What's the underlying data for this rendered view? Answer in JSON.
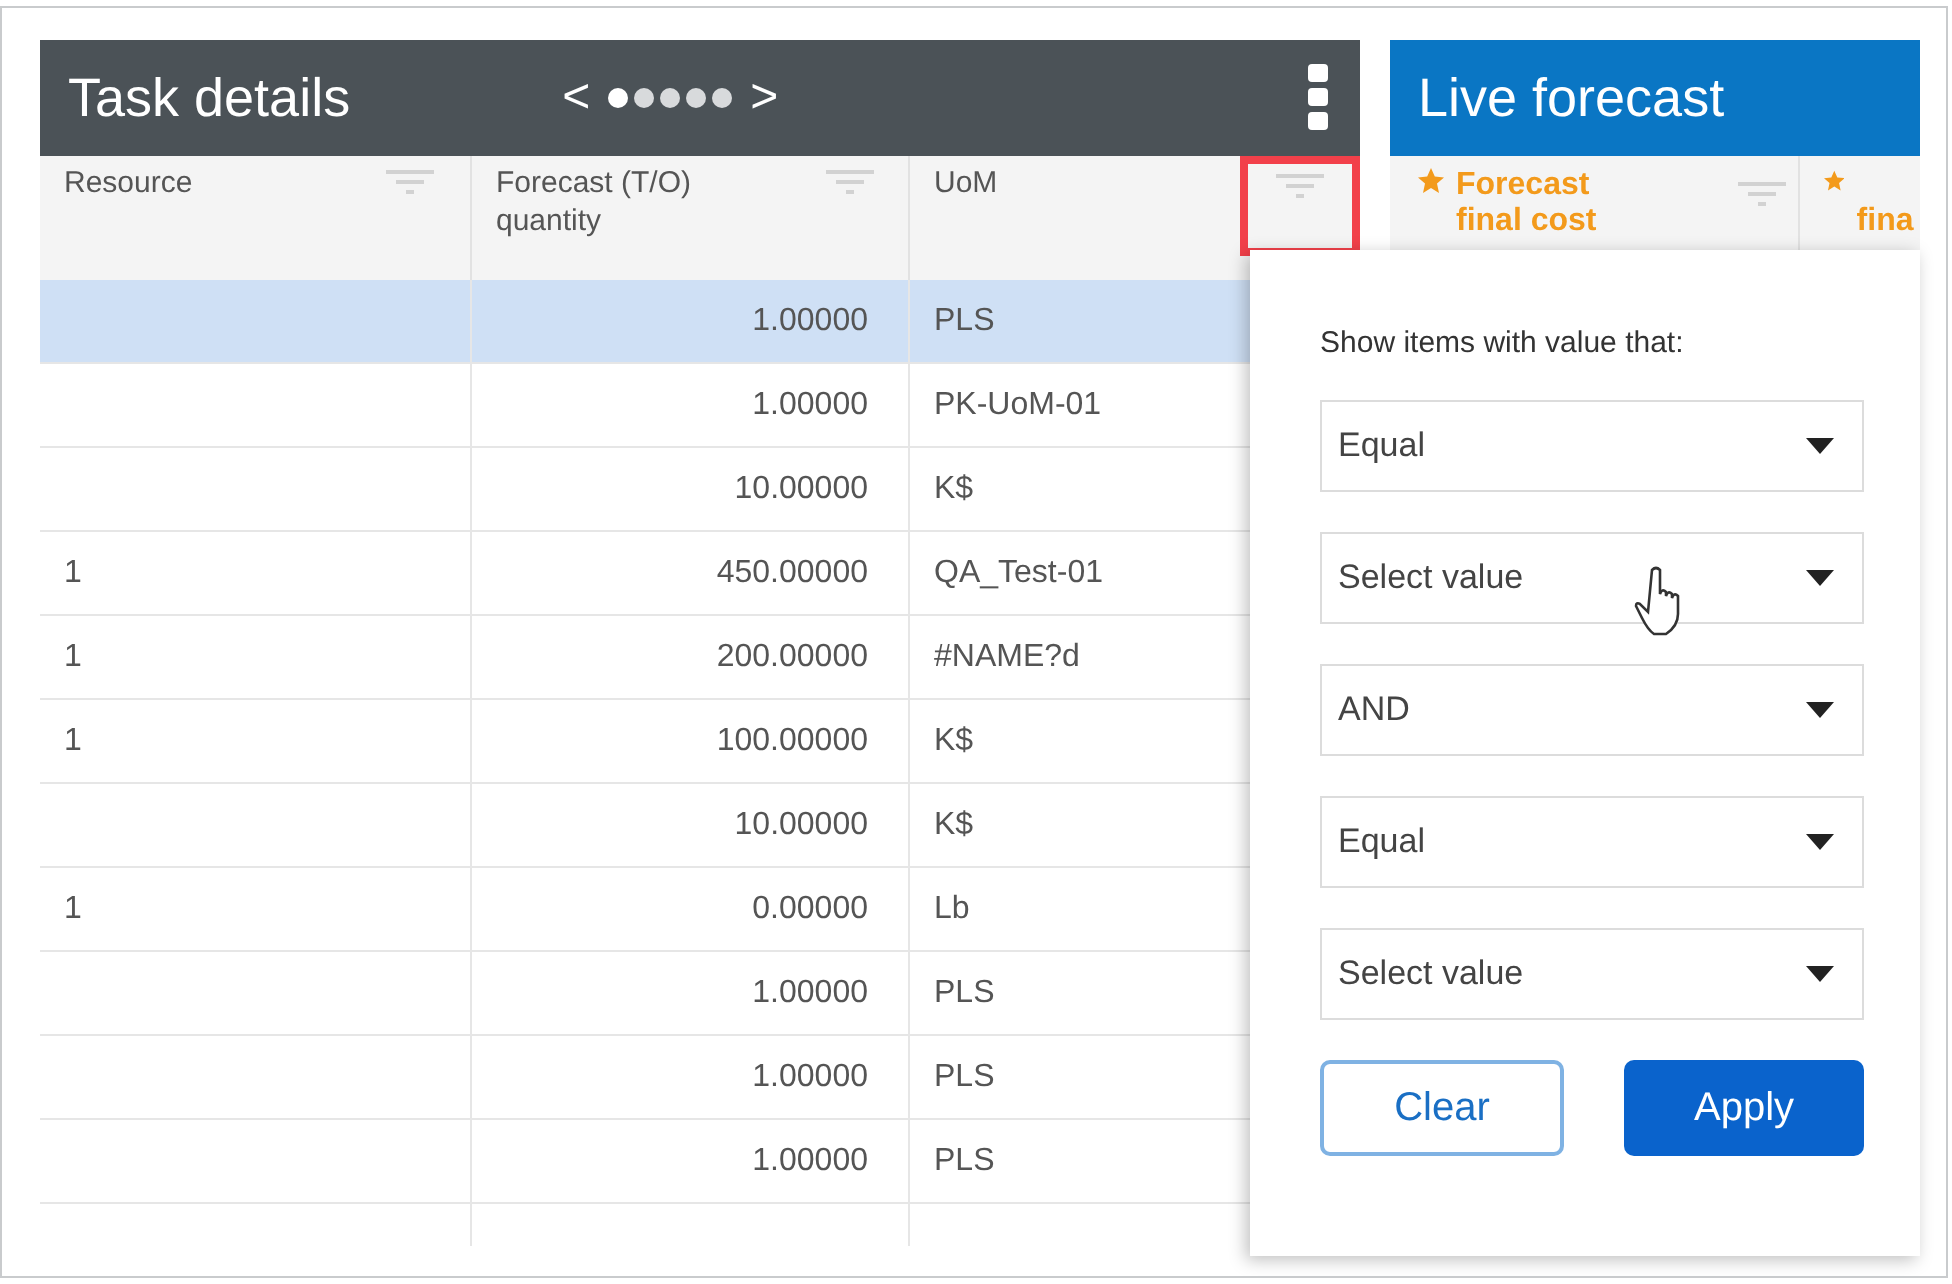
{
  "task_panel": {
    "title": "Task details",
    "pager": {
      "prev": "<",
      "next": ">",
      "dots": [
        {
          "selected": true
        },
        {
          "selected": false
        },
        {
          "selected": false
        },
        {
          "selected": false
        },
        {
          "selected": false
        }
      ]
    }
  },
  "table": {
    "columns": [
      {
        "label": "Resource",
        "highlighted": false
      },
      {
        "label": "Forecast (T/O) quantity",
        "highlighted": false
      },
      {
        "label": "UoM",
        "highlighted": true
      }
    ],
    "rows": [
      {
        "selected": true,
        "cells": [
          "",
          "1.00000",
          "PLS"
        ]
      },
      {
        "selected": false,
        "cells": [
          "",
          "1.00000",
          "PK-UoM-01"
        ]
      },
      {
        "selected": false,
        "cells": [
          "",
          "10.00000",
          "K$"
        ]
      },
      {
        "selected": false,
        "cells": [
          "1",
          "450.00000",
          "QA_Test-01"
        ]
      },
      {
        "selected": false,
        "cells": [
          "1",
          "200.00000",
          "#NAME?d"
        ]
      },
      {
        "selected": false,
        "cells": [
          "1",
          "100.00000",
          "K$"
        ]
      },
      {
        "selected": false,
        "cells": [
          "",
          "10.00000",
          "K$"
        ]
      },
      {
        "selected": false,
        "cells": [
          "1",
          "0.00000",
          "Lb"
        ]
      },
      {
        "selected": false,
        "cells": [
          "",
          "1.00000",
          "PLS"
        ]
      },
      {
        "selected": false,
        "cells": [
          "",
          "1.00000",
          "PLS"
        ]
      },
      {
        "selected": false,
        "cells": [
          "",
          "1.00000",
          "PLS"
        ]
      },
      {
        "selected": false,
        "cells": [
          "",
          "",
          ""
        ]
      }
    ]
  },
  "live_panel": {
    "title": "Live forecast",
    "columns": [
      {
        "label": "Forecast final cost",
        "starred": true,
        "cut": false
      },
      {
        "label": "fina",
        "starred": true,
        "cut": true
      }
    ]
  },
  "filter_popup": {
    "title": "Show items with value that:",
    "dropdowns": [
      {
        "value": "Equal"
      },
      {
        "value": "Select value"
      },
      {
        "value": "AND"
      },
      {
        "value": "Equal"
      },
      {
        "value": "Select value"
      }
    ],
    "buttons": [
      {
        "label": "Clear",
        "kind": "secondary"
      },
      {
        "label": "Apply",
        "kind": "primary"
      }
    ]
  }
}
